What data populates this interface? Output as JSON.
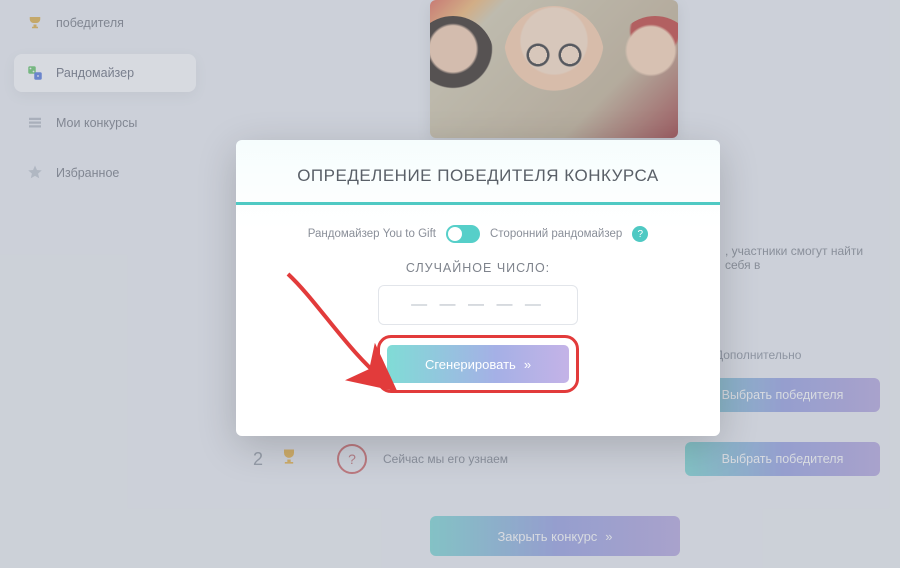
{
  "sidebar": {
    "items": [
      {
        "label": "победителя",
        "icon": "trophy-icon"
      },
      {
        "label": "Рандомайзер",
        "icon": "dice-icon",
        "active": true
      },
      {
        "label": "Мои конкурсы",
        "icon": "list-icon"
      },
      {
        "label": "Избранное",
        "icon": "star-icon"
      }
    ]
  },
  "main": {
    "sideText": ", участники смогут найти себя в",
    "extraLabel": "Дополнительно",
    "selectWinner": "Выбрать победителя",
    "row2": {
      "place": "2",
      "question": "?",
      "text": "Сейчас мы его узнаем"
    },
    "closeContest": "Закрыть конкурс"
  },
  "modal": {
    "title": "ОПРЕДЕЛЕНИЕ ПОБЕДИТЕЛЯ КОНКУРСА",
    "optionA": "Рандомайзер You to Gift",
    "optionB": "Сторонний рандомайзер",
    "helpMark": "?",
    "randLabel": "СЛУЧАЙНОЕ ЧИСЛО:",
    "placeholder": "— — — — —",
    "generate": "Сгенерировать"
  },
  "glyphs": {
    "chevrons": "»"
  }
}
